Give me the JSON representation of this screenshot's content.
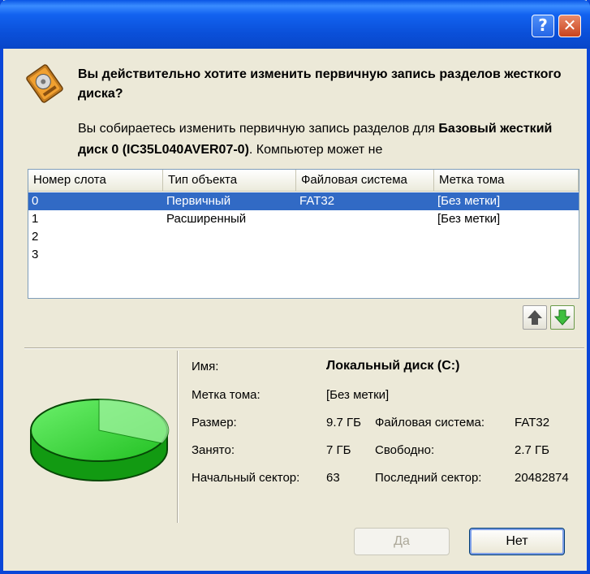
{
  "window": {
    "help_label": "?",
    "close_label": "✕"
  },
  "icons": {
    "warning": "disk-warning-icon",
    "pie": "disk-usage-pie-icon",
    "up": "arrow-up-icon",
    "down": "arrow-down-icon"
  },
  "colors": {
    "selection": "#316ac5",
    "pie_green": "#2ed12e",
    "titlebar": "#0a4fd8"
  },
  "question": "Вы действительно хотите изменить первичную запись разделов жесткого диска?",
  "description": {
    "prefix": "Вы собираетесь изменить первичную запись разделов для ",
    "disk_name": "Базовый жесткий диск 0 (IC35L040AVER07-0)",
    "suffix": ". Компьютер может не"
  },
  "table": {
    "headers": [
      "Номер слота",
      "Тип объекта",
      "Файловая система",
      "Метка тома"
    ],
    "rows": [
      {
        "slot": "0",
        "type": "Первичный",
        "fs": "FAT32",
        "label": "[Без метки]",
        "selected": true
      },
      {
        "slot": "1",
        "type": "Расширенный",
        "fs": "",
        "label": "[Без метки]",
        "selected": false
      },
      {
        "slot": "2",
        "type": "",
        "fs": "",
        "label": "",
        "selected": false
      },
      {
        "slot": "3",
        "type": "",
        "fs": "",
        "label": "",
        "selected": false
      }
    ]
  },
  "properties": {
    "name_label": "Имя:",
    "name_value": "Локальный диск (C:)",
    "volume_label_label": "Метка тома:",
    "volume_label_value": "[Без метки]",
    "size_label": "Размер:",
    "size_value": "9.7 ГБ",
    "fs_label": "Файловая система:",
    "fs_value": "FAT32",
    "used_label": "Занято:",
    "used_value": "7 ГБ",
    "free_label": "Свободно:",
    "free_value": "2.7 ГБ",
    "start_label": "Начальный сектор:",
    "start_value": "63",
    "end_label": "Последний сектор:",
    "end_value": "20482874"
  },
  "buttons": {
    "yes": "Да",
    "no": "Нет"
  }
}
